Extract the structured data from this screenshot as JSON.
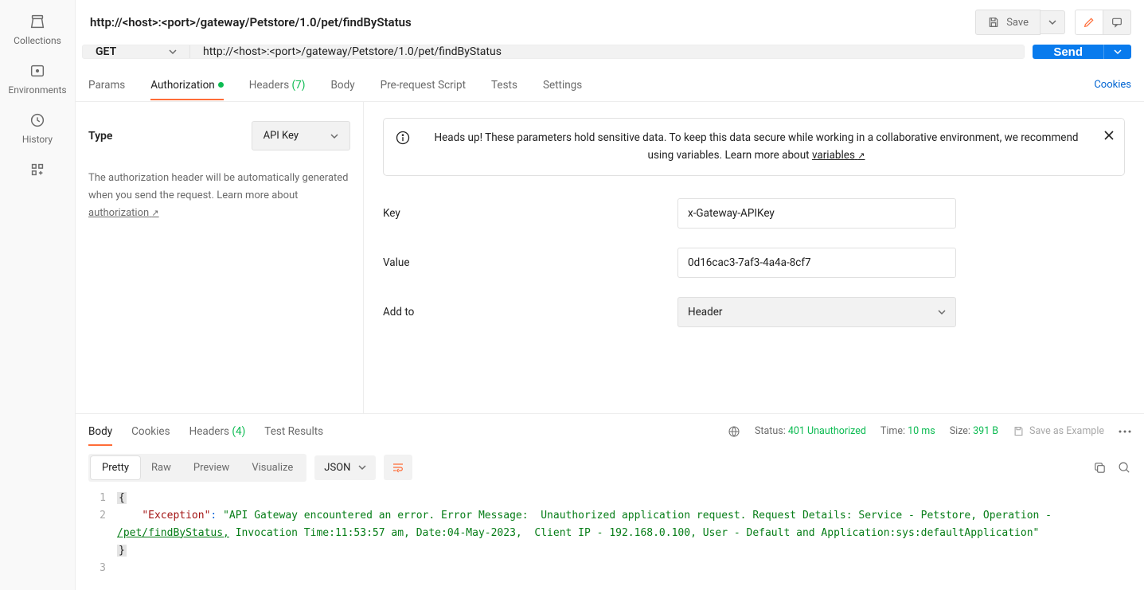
{
  "sidebar": {
    "items": [
      {
        "label": "Collections"
      },
      {
        "label": "Environments"
      },
      {
        "label": "History"
      }
    ]
  },
  "request": {
    "title": "http://<host>:<port>/gateway/Petstore/1.0/pet/findByStatus",
    "method": "GET",
    "url": "http://<host>:<port>/gateway/Petstore/1.0/pet/findByStatus",
    "save_label": "Save",
    "send_label": "Send"
  },
  "tabs": {
    "params": "Params",
    "auth": "Authorization",
    "headers": "Headers",
    "headers_count": "(7)",
    "body": "Body",
    "pre": "Pre-request Script",
    "tests": "Tests",
    "settings": "Settings",
    "cookies": "Cookies"
  },
  "auth": {
    "type_label": "Type",
    "type_value": "API Key",
    "desc1": "The authorization header will be automatically generated when you send the request. Learn more about ",
    "desc_link": "authorization",
    "banner": "Heads up! These parameters hold sensitive data. To keep this data secure while working in a collaborative environment, we recommend using variables. Learn more about ",
    "banner_link": "variables",
    "key_label": "Key",
    "key_value": "x-Gateway-APIKey",
    "value_label": "Value",
    "value_value": "0d16cac3-7af3-4a4a-8cf7",
    "addto_label": "Add to",
    "addto_value": "Header"
  },
  "response": {
    "tabs": {
      "body": "Body",
      "cookies": "Cookies",
      "headers": "Headers",
      "headers_count": "(4)",
      "tests": "Test Results"
    },
    "status_label": "Status:",
    "status_value": "401 Unauthorized",
    "time_label": "Time:",
    "time_value": "10 ms",
    "size_label": "Size:",
    "size_value": "391 B",
    "save_example": "Save as Example",
    "view": {
      "pretty": "Pretty",
      "raw": "Raw",
      "preview": "Preview",
      "visualize": "Visualize",
      "format": "JSON"
    },
    "code": {
      "key": "\"Exception\"",
      "val_pre": "\"API Gateway encountered an error. Error Message:  Unauthorized application request. Request Details: Service - Petstore, Operation - ",
      "val_link": "/pet/findByStatus,",
      "val_post": " Invocation Time:11:53:57 am, Date:04-May-2023,  Client IP - 192.168.0.100, User - Default and Application:sys:defaultApplication\""
    }
  }
}
